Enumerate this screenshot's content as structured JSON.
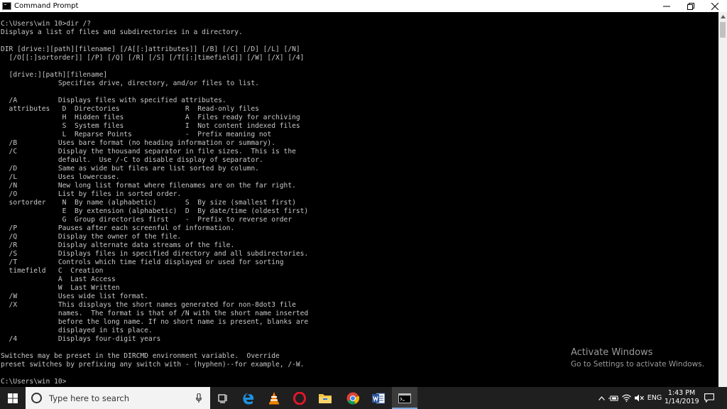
{
  "window": {
    "title": "Command Prompt"
  },
  "console": {
    "text": "C:\\Users\\win 10>dir /?\nDisplays a list of files and subdirectories in a directory.\n\nDIR [drive:][path][filename] [/A[[:]attributes]] [/B] [/C] [/D] [/L] [/N]\n  [/O[[:]sortorder]] [/P] [/Q] [/R] [/S] [/T[[:]timefield]] [/W] [/X] [/4]\n\n  [drive:][path][filename]\n              Specifies drive, directory, and/or files to list.\n\n  /A          Displays files with specified attributes.\n  attributes   D  Directories                R  Read-only files\n               H  Hidden files               A  Files ready for archiving\n               S  System files               I  Not content indexed files\n               L  Reparse Points             -  Prefix meaning not\n  /B          Uses bare format (no heading information or summary).\n  /C          Display the thousand separator in file sizes.  This is the\n              default.  Use /-C to disable display of separator.\n  /D          Same as wide but files are list sorted by column.\n  /L          Uses lowercase.\n  /N          New long list format where filenames are on the far right.\n  /O          List by files in sorted order.\n  sortorder    N  By name (alphabetic)       S  By size (smallest first)\n               E  By extension (alphabetic)  D  By date/time (oldest first)\n               G  Group directories first    -  Prefix to reverse order\n  /P          Pauses after each screenful of information.\n  /Q          Display the owner of the file.\n  /R          Display alternate data streams of the file.\n  /S          Displays files in specified directory and all subdirectories.\n  /T          Controls which time field displayed or used for sorting\n  timefield   C  Creation\n              A  Last Access\n              W  Last Written\n  /W          Uses wide list format.\n  /X          This displays the short names generated for non-8dot3 file\n              names.  The format is that of /N with the short name inserted\n              before the long name. If no short name is present, blanks are\n              displayed in its place.\n  /4          Displays four-digit years\n\nSwitches may be preset in the DIRCMD environment variable.  Override\npreset switches by prefixing any switch with - (hyphen)--for example, /-W.\n\nC:\\Users\\win 10>"
  },
  "watermark": {
    "title": "Activate Windows",
    "subtitle": "Go to Settings to activate Windows."
  },
  "taskbar": {
    "search_placeholder": "Type here to search",
    "language": "ENG",
    "time": "1:43 PM",
    "date": "1/14/2019"
  },
  "icons": {
    "start": "windows-logo-icon",
    "task_view": "task-view-icon",
    "edge": "edge-icon",
    "vlc": "vlc-icon",
    "opera": "opera-icon",
    "explorer": "file-explorer-icon",
    "chrome": "chrome-icon",
    "word": "word-icon",
    "cmd": "command-prompt-icon"
  },
  "colors": {
    "console_bg": "#000000",
    "console_text": "#c8c8c8",
    "taskbar_bg": "#1f1f1f",
    "titlebar_bg": "#ffffff"
  }
}
